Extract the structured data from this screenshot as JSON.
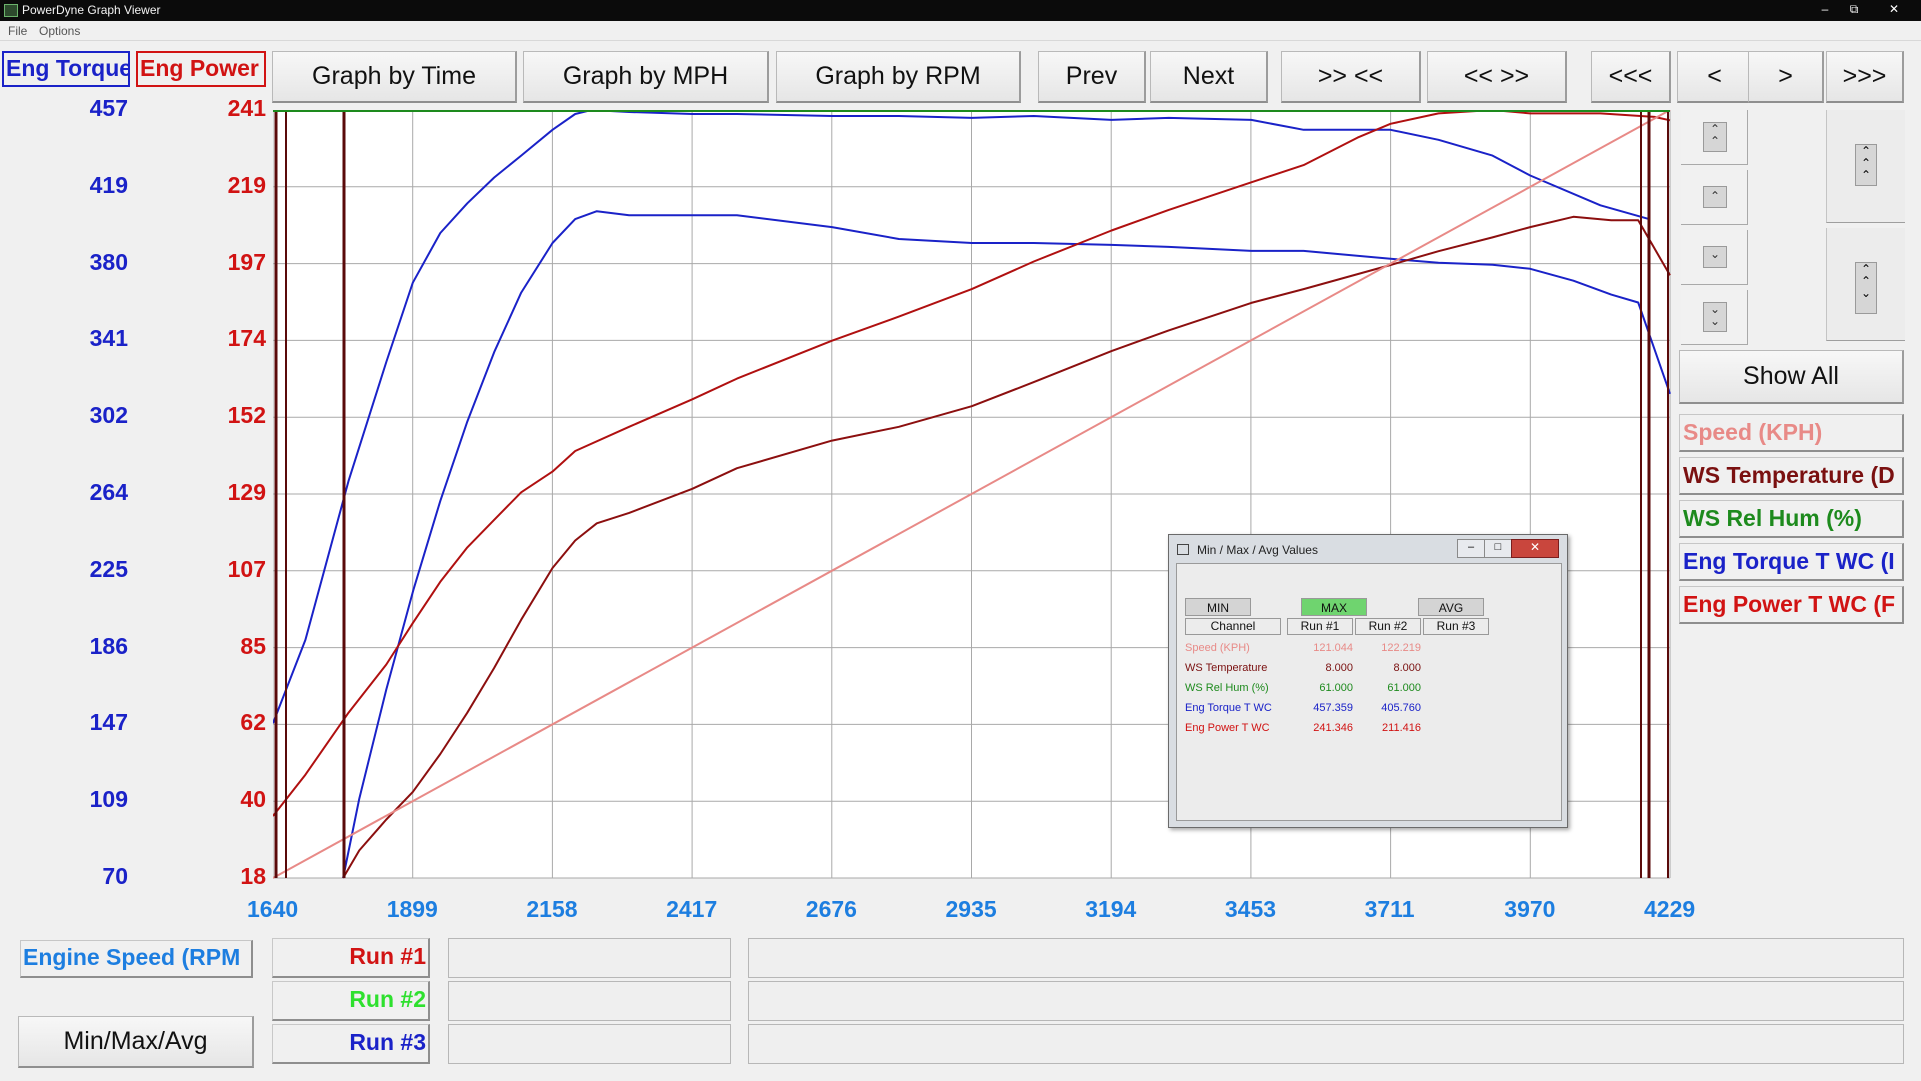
{
  "window": {
    "title": "PowerDyne Graph Viewer",
    "menu": [
      "File",
      "Options"
    ],
    "controls": [
      "–",
      "⧉",
      "✕"
    ]
  },
  "axis_headers": {
    "torque": "Eng Torque",
    "power": "Eng Power"
  },
  "toolbar": {
    "graph_time": "Graph by Time",
    "graph_mph": "Graph by MPH",
    "graph_rpm": "Graph by RPM",
    "prev": "Prev",
    "next": "Next",
    "zoom_in": ">> <<",
    "zoom_out": "<< >>",
    "first": "<<<",
    "back": "<",
    "forward": ">",
    "last": ">>>"
  },
  "side": {
    "show_all": "Show All",
    "legend": [
      {
        "label": "Speed (KPH)",
        "color": "#e88a87"
      },
      {
        "label": "WS Temperature (D",
        "color": "#7a1010"
      },
      {
        "label": "WS Rel Hum (%)",
        "color": "#1d8a1d"
      },
      {
        "label": "Eng Torque T WC (I",
        "color": "#1a22c8"
      },
      {
        "label": "Eng Power T WC (F",
        "color": "#d11313"
      }
    ],
    "scroll_icons": [
      "double-up-icon",
      "up-icon",
      "down-icon",
      "double-down-icon"
    ]
  },
  "bottom": {
    "x_channel": "Engine Speed (RPM",
    "minmax_button": "Min/Max/Avg",
    "runs": [
      {
        "label": "Run #1",
        "color": "#d11313"
      },
      {
        "label": "Run #2",
        "color": "#2ee02e"
      },
      {
        "label": "Run #3",
        "color": "#1a22c8"
      }
    ]
  },
  "dialog": {
    "title": "Min / Max / Avg Values",
    "tabs": [
      "MIN",
      "MAX",
      "AVG"
    ],
    "active_tab": "MAX",
    "columns": [
      "Channel",
      "Run #1",
      "Run #2",
      "Run #3"
    ],
    "rows": [
      {
        "channel": "Speed (KPH)",
        "run1": "121.044",
        "run2": "122.219",
        "color": "#e88a87"
      },
      {
        "channel": "WS Temperature",
        "run1": "8.000",
        "run2": "8.000",
        "color": "#7a1010"
      },
      {
        "channel": "WS Rel Hum (%)",
        "run1": "61.000",
        "run2": "61.000",
        "color": "#1d8a1d"
      },
      {
        "channel": "Eng Torque T WC",
        "run1": "457.359",
        "run2": "405.760",
        "color": "#1a22c8"
      },
      {
        "channel": "Eng Power T WC",
        "run1": "241.346",
        "run2": "211.416",
        "color": "#d11313"
      }
    ]
  },
  "chart_data": {
    "type": "line",
    "x_ticks": [
      "1640",
      "1899",
      "2158",
      "2417",
      "2676",
      "2935",
      "3194",
      "3453",
      "3711",
      "3970",
      "4229"
    ],
    "xlim": [
      1640,
      4229
    ],
    "torque_ticks": [
      "457",
      "419",
      "380",
      "341",
      "302",
      "264",
      "225",
      "186",
      "147",
      "109",
      "70"
    ],
    "torque_lim": [
      70,
      457
    ],
    "power_ticks": [
      "241",
      "219",
      "197",
      "174",
      "152",
      "129",
      "107",
      "85",
      "62",
      "40",
      "18"
    ],
    "power_lim": [
      18,
      241
    ],
    "grid": true,
    "series": [
      {
        "name": "Eng Torque T WC",
        "run": "Run #1",
        "axis": "torque",
        "color": "#1a22c8",
        "x": [
          1640,
          1700,
          1780,
          1850,
          1899,
          1950,
          2000,
          2050,
          2100,
          2158,
          2200,
          2230,
          2300,
          2417,
          2500,
          2676,
          2800,
          2935,
          3050,
          3194,
          3300,
          3453,
          3550,
          3711,
          3800,
          3900,
          3970,
          4100,
          4190
        ],
        "y": [
          148,
          190,
          270,
          330,
          370,
          395,
          410,
          423,
          434,
          447,
          455,
          457,
          456,
          455,
          455,
          454,
          454,
          453,
          454,
          452,
          453,
          452,
          447,
          447,
          442,
          434,
          424,
          409,
          402
        ]
      },
      {
        "name": "Eng Torque T WC",
        "run": "Run #2",
        "axis": "torque",
        "color": "#1a22c8",
        "x": [
          1770,
          1800,
          1850,
          1900,
          1950,
          2000,
          2050,
          2100,
          2158,
          2200,
          2240,
          2300,
          2417,
          2500,
          2676,
          2800,
          2935,
          3050,
          3194,
          3300,
          3453,
          3550,
          3711,
          3800,
          3900,
          3970,
          4050,
          4120,
          4170,
          4229
        ],
        "y": [
          70,
          110,
          165,
          215,
          260,
          300,
          335,
          365,
          390,
          402,
          406,
          404,
          404,
          404,
          398,
          392,
          390,
          390,
          389,
          388,
          386,
          386,
          382,
          380,
          379,
          377,
          371,
          364,
          360,
          314
        ]
      },
      {
        "name": "Eng Power T WC",
        "run": "Run #1",
        "axis": "power",
        "color": "#b01010",
        "x": [
          1640,
          1700,
          1780,
          1850,
          1899,
          1950,
          2000,
          2050,
          2100,
          2158,
          2200,
          2300,
          2417,
          2500,
          2676,
          2800,
          2935,
          3050,
          3194,
          3300,
          3453,
          3550,
          3650,
          3711,
          3800,
          3900,
          3970,
          4100,
          4200,
          4229
        ],
        "y": [
          36,
          48,
          66,
          80,
          92,
          104,
          114,
          122,
          130,
          136,
          142,
          149,
          157,
          163,
          174,
          181,
          189,
          197,
          206,
          212,
          220,
          225,
          233,
          237,
          240,
          241,
          240,
          240,
          239,
          238
        ]
      },
      {
        "name": "Eng Power T WC",
        "run": "Run #2",
        "axis": "power",
        "color": "#8c0f0f",
        "x": [
          1770,
          1800,
          1850,
          1899,
          1950,
          2000,
          2050,
          2100,
          2158,
          2200,
          2240,
          2300,
          2417,
          2500,
          2676,
          2800,
          2935,
          3050,
          3194,
          3300,
          3453,
          3550,
          3711,
          3800,
          3900,
          3970,
          4050,
          4120,
          4170,
          4229
        ],
        "y": [
          18,
          26,
          35,
          43,
          54,
          66,
          79,
          93,
          108,
          116,
          121,
          124,
          131,
          137,
          145,
          149,
          155,
          162,
          171,
          177,
          185,
          189,
          196,
          200,
          204,
          207,
          210,
          209,
          209,
          193
        ]
      },
      {
        "name": "Speed (KPH)",
        "axis": "power",
        "color": "#e88a87",
        "x": [
          1640,
          4229
        ],
        "y": [
          18,
          241
        ]
      }
    ]
  }
}
